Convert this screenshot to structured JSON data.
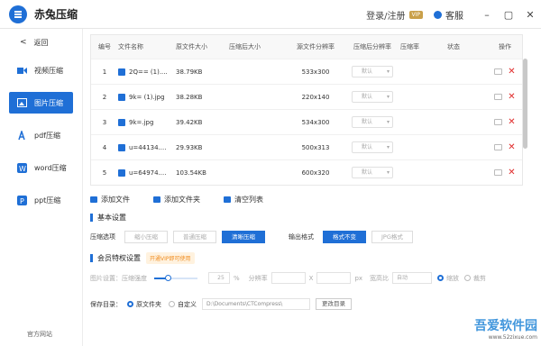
{
  "app": {
    "title": "赤兔压缩",
    "login": "登录/注册",
    "vip": "VIP",
    "service": "客服"
  },
  "sidebar": {
    "back": "返回",
    "items": [
      "视频压缩",
      "图片压缩",
      "pdf压缩",
      "word压缩",
      "ppt压缩"
    ],
    "footer": "官方网站"
  },
  "table": {
    "headers": [
      "编号",
      "文件名称",
      "原文件大小",
      "压缩后大小",
      "源文件分辨率",
      "压缩后分辨率",
      "压缩率",
      "状态",
      "操作"
    ],
    "rows": [
      {
        "n": "1",
        "name": "2Q== (1)....",
        "size": "38.79KB",
        "res": "533x300",
        "sel": "默认"
      },
      {
        "n": "2",
        "name": "9k= (1).jpg",
        "size": "38.28KB",
        "res": "220x140",
        "sel": "默认"
      },
      {
        "n": "3",
        "name": "9k=.jpg",
        "size": "39.42KB",
        "res": "534x300",
        "sel": "默认"
      },
      {
        "n": "4",
        "name": "u=44134....",
        "size": "29.93KB",
        "res": "500x313",
        "sel": "默认"
      },
      {
        "n": "5",
        "name": "u=64974....",
        "size": "103.54KB",
        "res": "600x320",
        "sel": "默认"
      }
    ]
  },
  "actions": {
    "add_file": "添加文件",
    "add_folder": "添加文件夹",
    "clear": "清空列表"
  },
  "basic": {
    "title": "基本设置",
    "mode_label": "压缩选项",
    "modes": [
      "缩小压缩",
      "普通压缩",
      "清晰压缩"
    ],
    "format_label": "输出格式",
    "formats": [
      "格式不变",
      "JPG格式"
    ]
  },
  "member": {
    "title": "会员特权设置",
    "tag": "开通VIP即可使用"
  },
  "imgset": {
    "label": "图片设置：压缩强度",
    "percent": "25",
    "pct": "%",
    "res": "分辨率",
    "x": "X",
    "px": "px",
    "ratio": "宽高比",
    "auto": "自动",
    "scale": "缩放",
    "crop": "裁剪"
  },
  "save": {
    "label": "保存目录：",
    "orig": "原文件夹",
    "custom": "自定义",
    "path": "D:\\Documents\\CTCompress\\",
    "change": "更改目录"
  },
  "watermark": {
    "title": "吾爱软件园",
    "url": "www.52zixue.com"
  }
}
